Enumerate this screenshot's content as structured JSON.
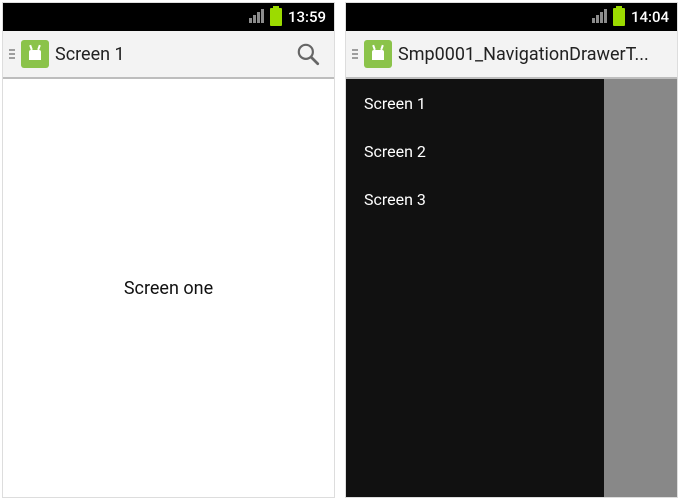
{
  "left": {
    "status_time": "13:59",
    "action_bar_title": "Screen 1",
    "content_text": "Screen one"
  },
  "right": {
    "status_time": "14:04",
    "action_bar_title": "Smp0001_NavigationDrawerT...",
    "drawer": {
      "items": [
        {
          "label": "Screen 1"
        },
        {
          "label": "Screen 2"
        },
        {
          "label": "Screen 3"
        }
      ]
    }
  }
}
